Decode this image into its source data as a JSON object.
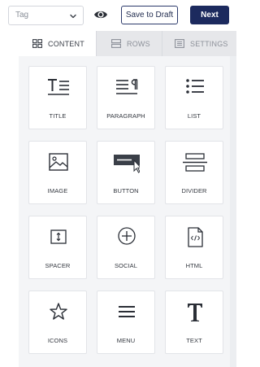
{
  "toolbar": {
    "tag_select_value": "Tag",
    "save_draft_label": "Save to Draft",
    "next_label": "Next"
  },
  "tabs": [
    {
      "label": "CONTENT",
      "active": true,
      "icon": "grid-icon"
    },
    {
      "label": "ROWS",
      "active": false,
      "icon": "rows-icon"
    },
    {
      "label": "SETTINGS",
      "active": false,
      "icon": "settings-icon"
    }
  ],
  "blocks": [
    {
      "label": "TITLE",
      "icon": "title-icon"
    },
    {
      "label": "PARAGRAPH",
      "icon": "paragraph-icon"
    },
    {
      "label": "LIST",
      "icon": "list-icon"
    },
    {
      "label": "IMAGE",
      "icon": "image-icon"
    },
    {
      "label": "BUTTON",
      "icon": "button-icon"
    },
    {
      "label": "DIVIDER",
      "icon": "divider-icon"
    },
    {
      "label": "SPACER",
      "icon": "spacer-icon"
    },
    {
      "label": "SOCIAL",
      "icon": "social-icon"
    },
    {
      "label": "HTML",
      "icon": "html-icon"
    },
    {
      "label": "ICONS",
      "icon": "star-icon"
    },
    {
      "label": "MENU",
      "icon": "menu-icon"
    },
    {
      "label": "TEXT",
      "icon": "text-icon"
    }
  ],
  "colors": {
    "primary": "#1c2a5e",
    "icon": "#3a3f48",
    "panel_bg": "#f4f5f7"
  }
}
